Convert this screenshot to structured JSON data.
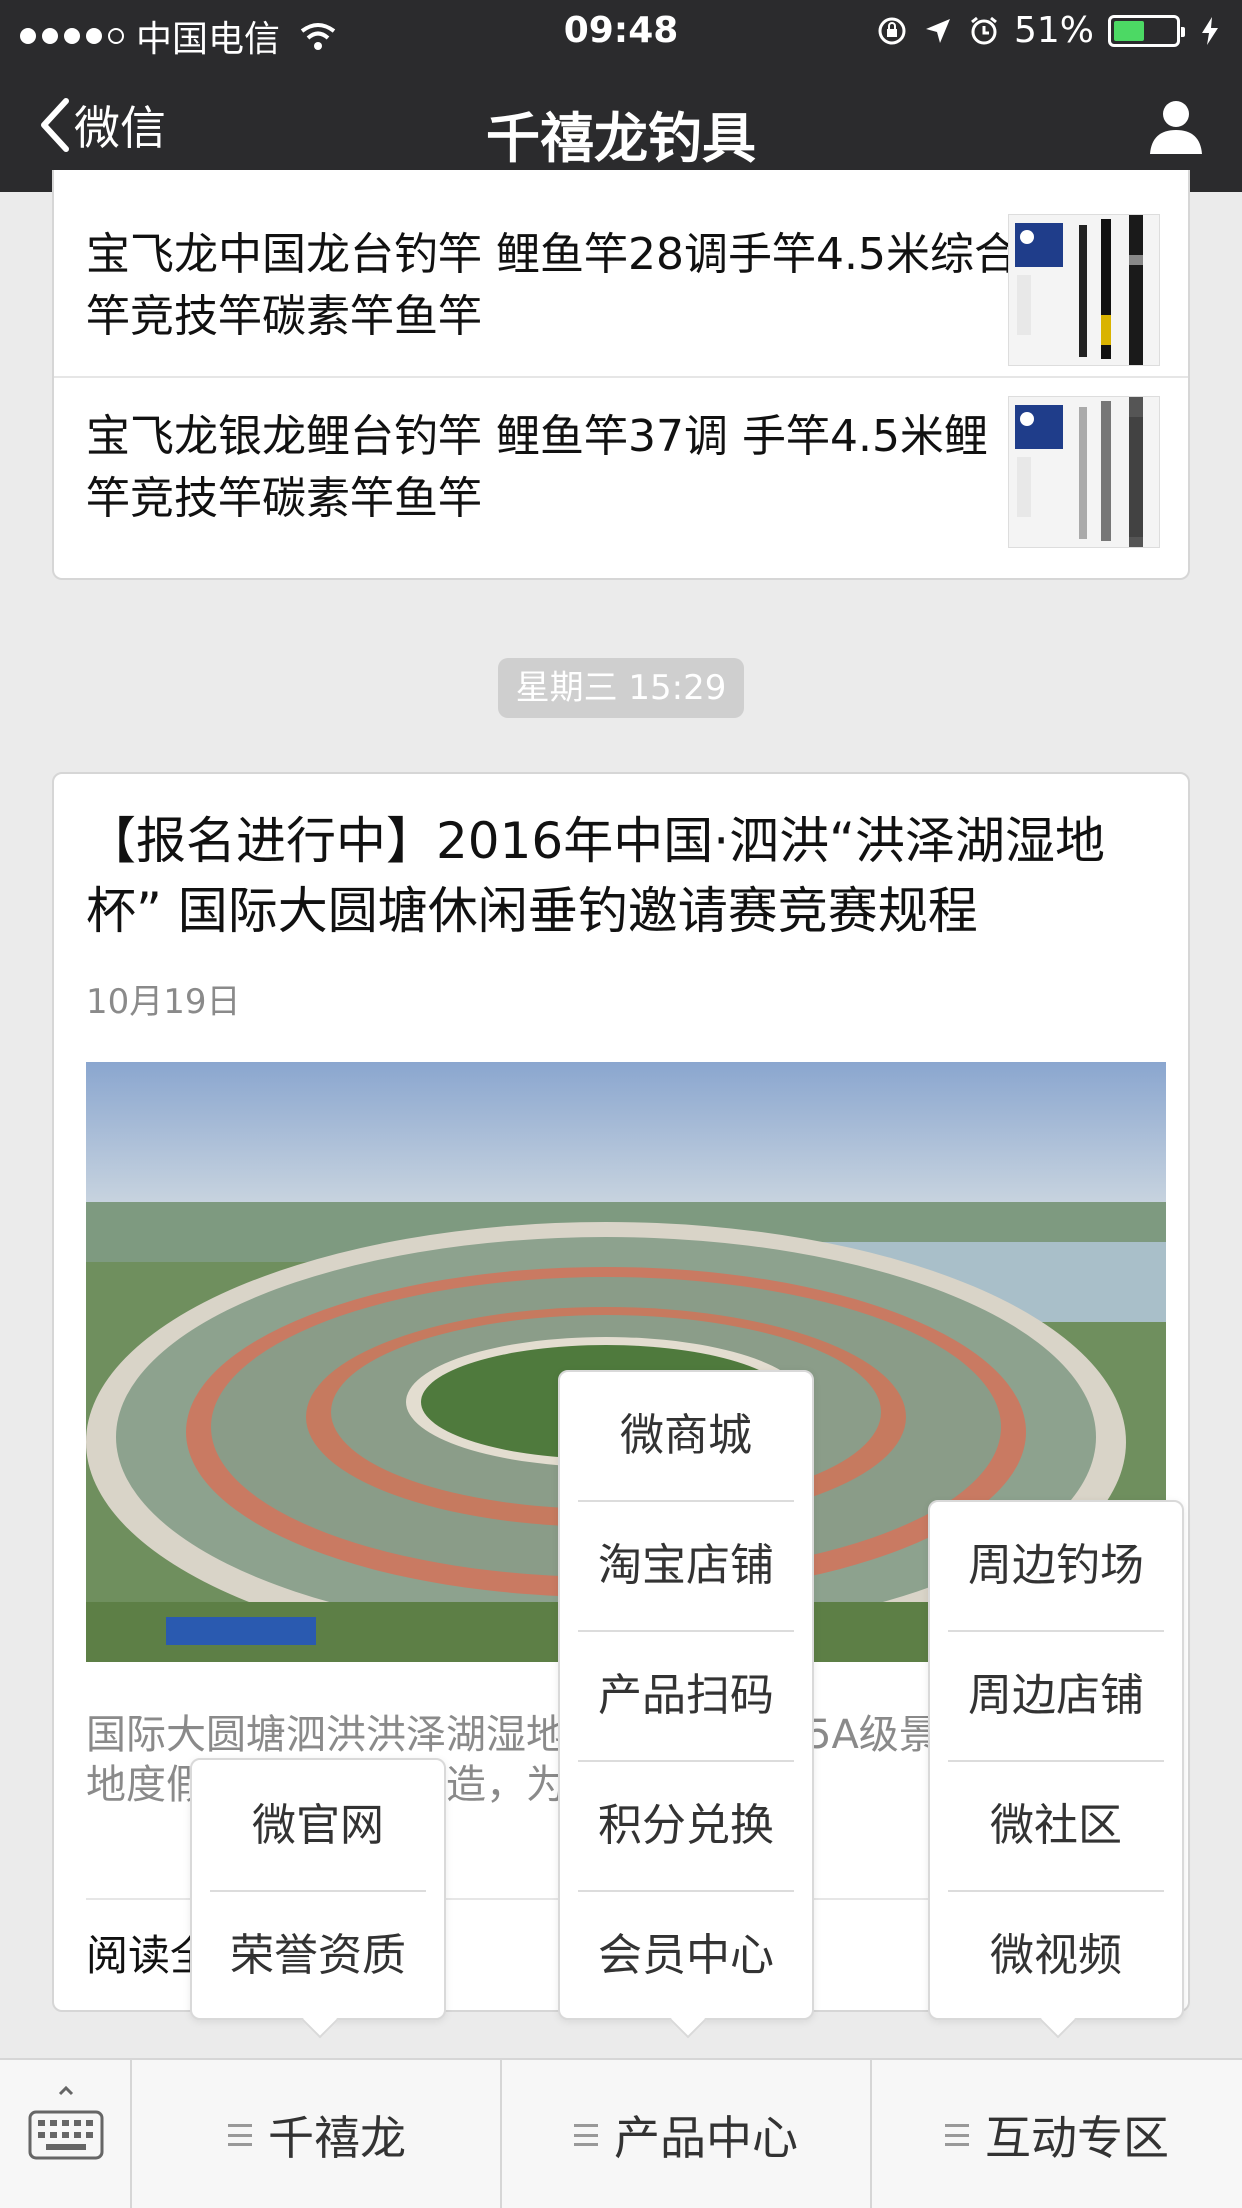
{
  "status_bar": {
    "carrier": "中国电信",
    "time": "09:48",
    "battery": "51%",
    "battery_level": 0.51
  },
  "nav": {
    "back_label": "微信",
    "title": "千禧龙钓具"
  },
  "articles": [
    {
      "title": "宝飞龙中国龙台钓竿 鲤鱼竿28调手竿4.5米综合竿竞技竿碳素竿鱼竿"
    },
    {
      "title": "宝飞龙银龙鲤台钓竿 鲤鱼竿37调 手竿4.5米鲤竿竞技竿碳素竿鱼竿"
    }
  ],
  "timestamp": "星期三 15:29",
  "main_article": {
    "title": "【报名进行中】2016年中国·泗洪“洪泽湖湿地杯” 国际大圆塘休闲垂钓邀请赛竞赛规程",
    "date": "10月19日",
    "description": "国际大圆塘泗洪洪泽湖湿地公园位于国家5A级景区洪泽湖湿地度假区，经批准建造，为国际钓鱼基地",
    "read_all": "阅读全文"
  },
  "menus": {
    "brand": {
      "label": "千禧龙",
      "items": [
        "微官网",
        "荣誉资质"
      ]
    },
    "products": {
      "label": "产品中心",
      "items": [
        "微商城",
        "淘宝店铺",
        "产品扫码",
        "积分兑换",
        "会员中心"
      ]
    },
    "interactive": {
      "label": "互动专区",
      "items": [
        "周边钓场",
        "周边店铺",
        "微社区",
        "微视频"
      ]
    }
  },
  "colors": {
    "header_bg": "#2b2b2d",
    "page_bg": "#ebebeb",
    "battery_green": "#4cd964"
  }
}
